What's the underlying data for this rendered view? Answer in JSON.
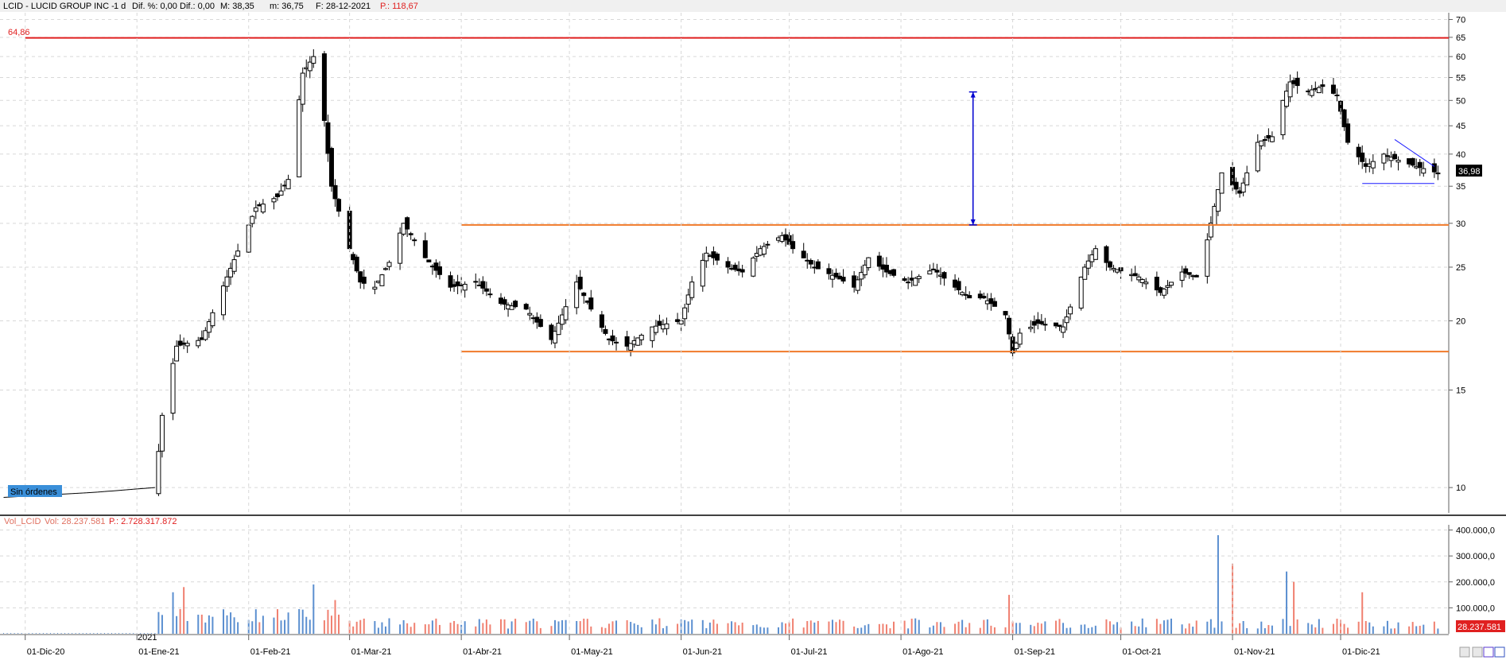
{
  "header": {
    "symbol": "LCID - LUCID GROUP INC -",
    "period": "1 d",
    "dif_pct": "Dif. %: 0,00",
    "dif": "Dif.: 0,00",
    "max": "M: 38,35",
    "min": "m: 36,75",
    "date": "F: 28-12-2021",
    "price": "P.: 118,67"
  },
  "volume_header": {
    "name": "Vol_LCID",
    "vol": "Vol: 28.237.581",
    "p": "P.: 2.728.317.872"
  },
  "badges": {
    "no_orders": "Sin órdenes",
    "last_price": "36,98",
    "last_volume": "28.237.581",
    "level_label": "64,86",
    "year_marker": "2021"
  },
  "colors": {
    "up": "#ffffff",
    "down": "#000000",
    "resistance": "#e02020",
    "range": "#f07a2a",
    "arrow": "#0000d0",
    "triangle": "#1a1aff",
    "vol_up": "#5b8fd0",
    "vol_down": "#f08070"
  },
  "chart_data": [
    {
      "type": "candlestick",
      "scale": "log",
      "ylim": [
        9,
        72
      ],
      "y_ticks": [
        10,
        15,
        20,
        25,
        30,
        35,
        40,
        45,
        50,
        55,
        60,
        65,
        70
      ],
      "x_ticks": [
        {
          "label": "01-Dic-20",
          "date": "2020-12-01"
        },
        {
          "label": "01-Ene-21",
          "date": "2021-01-01"
        },
        {
          "label": "01-Feb-21",
          "date": "2021-02-01"
        },
        {
          "label": "01-Mar-21",
          "date": "2021-03-01"
        },
        {
          "label": "01-Abr-21",
          "date": "2021-04-01"
        },
        {
          "label": "01-May-21",
          "date": "2021-05-01"
        },
        {
          "label": "01-Jun-21",
          "date": "2021-06-01"
        },
        {
          "label": "01-Jul-21",
          "date": "2021-07-01"
        },
        {
          "label": "01-Ago-21",
          "date": "2021-08-01"
        },
        {
          "label": "01-Sep-21",
          "date": "2021-09-01"
        },
        {
          "label": "01-Oct-21",
          "date": "2021-10-01"
        },
        {
          "label": "01-Nov-21",
          "date": "2021-11-01"
        },
        {
          "label": "01-Dic-21",
          "date": "2021-12-01"
        }
      ],
      "levels": [
        {
          "value": 64.86,
          "from": "2020-12-01",
          "to": "2021-12-31",
          "role": "resistance"
        },
        {
          "value": 29.8,
          "from": "2021-04-01",
          "to": "2021-12-31",
          "role": "range"
        },
        {
          "value": 17.6,
          "from": "2021-04-01",
          "to": "2021-12-31",
          "role": "range"
        }
      ],
      "measure_arrow": {
        "date": "2021-08-21",
        "from": 29.8,
        "to": 51.8
      },
      "triangle": [
        {
          "date": "2021-12-07",
          "value": 35.4
        },
        {
          "date": "2021-12-16",
          "value": 42.5
        },
        {
          "date": "2021-12-27",
          "value": 38.0
        },
        {
          "date": "2021-12-27",
          "value": 35.4
        }
      ],
      "anchors": [
        [
          "2020-11-25",
          9.6
        ],
        [
          "2020-12-20",
          9.8
        ],
        [
          "2021-01-06",
          10.0
        ],
        [
          "2021-01-08",
          13.5
        ],
        [
          "2021-01-12",
          18.0
        ],
        [
          "2021-01-19",
          18.5
        ],
        [
          "2021-01-26",
          24.0
        ],
        [
          "2021-02-03",
          32.0
        ],
        [
          "2021-02-09",
          33.5
        ],
        [
          "2021-02-12",
          36.0
        ],
        [
          "2021-02-16",
          56.0
        ],
        [
          "2021-02-19",
          60.0
        ],
        [
          "2021-02-22",
          46.0
        ],
        [
          "2021-02-24",
          35.0
        ],
        [
          "2021-03-01",
          27.0
        ],
        [
          "2021-03-04",
          23.5
        ],
        [
          "2021-03-08",
          23.0
        ],
        [
          "2021-03-12",
          25.5
        ],
        [
          "2021-03-16",
          30.0
        ],
        [
          "2021-03-22",
          26.0
        ],
        [
          "2021-03-29",
          23.0
        ],
        [
          "2021-04-05",
          23.5
        ],
        [
          "2021-04-12",
          21.5
        ],
        [
          "2021-04-19",
          21.0
        ],
        [
          "2021-04-26",
          18.5
        ],
        [
          "2021-05-03",
          23.5
        ],
        [
          "2021-05-07",
          21.0
        ],
        [
          "2021-05-12",
          18.5
        ],
        [
          "2021-05-17",
          18.0
        ],
        [
          "2021-05-24",
          19.5
        ],
        [
          "2021-06-01",
          20.0
        ],
        [
          "2021-06-04",
          23.5
        ],
        [
          "2021-06-08",
          26.5
        ],
        [
          "2021-06-14",
          25.0
        ],
        [
          "2021-06-18",
          24.5
        ],
        [
          "2021-06-23",
          27.0
        ],
        [
          "2021-06-29",
          28.5
        ],
        [
          "2021-07-02",
          27.0
        ],
        [
          "2021-07-08",
          25.0
        ],
        [
          "2021-07-14",
          24.0
        ],
        [
          "2021-07-19",
          23.0
        ],
        [
          "2021-07-23",
          26.0
        ],
        [
          "2021-07-28",
          24.5
        ],
        [
          "2021-08-03",
          23.5
        ],
        [
          "2021-08-10",
          24.8
        ],
        [
          "2021-08-16",
          23.0
        ],
        [
          "2021-08-20",
          22.0
        ],
        [
          "2021-08-24",
          22.0
        ],
        [
          "2021-08-30",
          20.5
        ],
        [
          "2021-09-01",
          17.5
        ],
        [
          "2021-09-03",
          19.0
        ],
        [
          "2021-09-08",
          19.8
        ],
        [
          "2021-09-15",
          19.5
        ],
        [
          "2021-09-21",
          25.0
        ],
        [
          "2021-09-24",
          27.0
        ],
        [
          "2021-09-28",
          25.0
        ],
        [
          "2021-10-06",
          24.0
        ],
        [
          "2021-10-12",
          22.5
        ],
        [
          "2021-10-18",
          24.5
        ],
        [
          "2021-10-22",
          24.0
        ],
        [
          "2021-10-25",
          28.0
        ],
        [
          "2021-10-29",
          37.0
        ],
        [
          "2021-11-03",
          34.0
        ],
        [
          "2021-11-08",
          42.0
        ],
        [
          "2021-11-12",
          43.0
        ],
        [
          "2021-11-15",
          50.0
        ],
        [
          "2021-11-17",
          54.0
        ],
        [
          "2021-11-22",
          52.0
        ],
        [
          "2021-11-26",
          53.0
        ],
        [
          "2021-11-30",
          51.0
        ],
        [
          "2021-12-03",
          42.0
        ],
        [
          "2021-12-08",
          38.0
        ],
        [
          "2021-12-13",
          40.0
        ],
        [
          "2021-12-17",
          39.0
        ],
        [
          "2021-12-22",
          38.0
        ],
        [
          "2021-12-28",
          36.98
        ]
      ]
    },
    {
      "type": "bar",
      "title": "Volume",
      "ylim": [
        0,
        420000
      ],
      "y_ticks": [
        100000,
        200000,
        300000,
        400000
      ],
      "y_tick_labels": [
        "100.000,0",
        "200.000,0",
        "300.000,0",
        "400.000,0"
      ],
      "spikes": [
        [
          "2021-01-11",
          160000
        ],
        [
          "2021-01-14",
          180000
        ],
        [
          "2021-02-19",
          190000
        ],
        [
          "2021-02-25",
          130000
        ],
        [
          "2021-08-31",
          150000
        ],
        [
          "2021-10-28",
          380000
        ],
        [
          "2021-11-01",
          270000
        ],
        [
          "2021-11-16",
          240000
        ],
        [
          "2021-11-18",
          200000
        ],
        [
          "2021-12-07",
          160000
        ]
      ]
    }
  ]
}
